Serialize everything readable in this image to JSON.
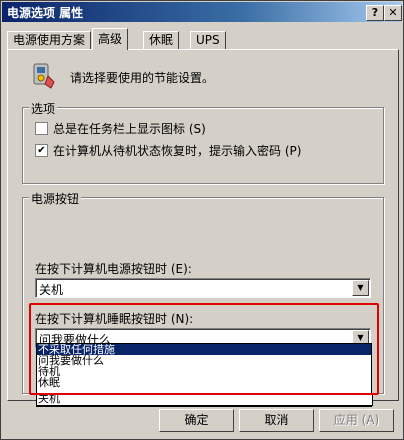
{
  "window": {
    "title": "电源选项 属性",
    "help_btn": "?",
    "close_btn": "✕"
  },
  "tabs": [
    {
      "label": "电源使用方案"
    },
    {
      "label": "高级"
    },
    {
      "label": "休眠"
    },
    {
      "label": "UPS"
    }
  ],
  "intro": {
    "icon": "power-settings-icon",
    "text": "请选择要使用的节能设置。"
  },
  "options": {
    "legend": "选项",
    "show_icon": {
      "label": "总是在任务栏上显示图标 (S)",
      "checked": false
    },
    "prompt_password": {
      "label": "在计算机从待机状态恢复时，提示输入密码 (P)",
      "checked": true
    }
  },
  "power_buttons": {
    "legend": "电源按钮",
    "power_label": "在按下计算机电源按钮时 (E):",
    "power_value": "关机",
    "sleep_label": "在按下计算机睡眠按钮时 (N):",
    "sleep_value": "问我要做什么",
    "dropdown_options": [
      "不采取任何措施",
      "问我要做什么",
      "待机",
      "休眠",
      "关机"
    ],
    "dropdown_selected_index": 0
  },
  "buttons": {
    "ok": "确定",
    "cancel": "取消",
    "apply": "应用 (A)"
  }
}
